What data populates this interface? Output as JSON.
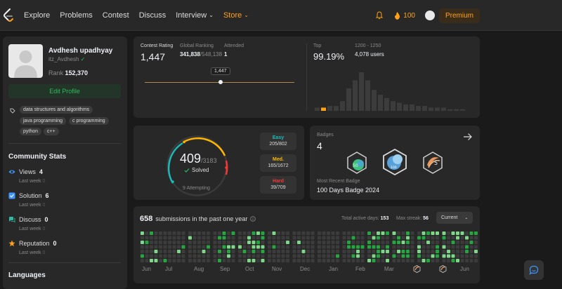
{
  "nav": {
    "items": [
      "Explore",
      "Problems",
      "Contest",
      "Discuss",
      "Interview",
      "Store"
    ],
    "coins": "100",
    "premium": "Premium"
  },
  "profile": {
    "name": "Avdhesh upadhyay",
    "handle": "itz_Avdhesh",
    "rank_label": "Rank",
    "rank": "152,370",
    "edit": "Edit Profile",
    "tags": [
      "data structures and algorithms",
      "java programming",
      "c programming",
      "python",
      "c++"
    ]
  },
  "community": {
    "title": "Community Stats",
    "stats": [
      {
        "label": "Views",
        "value": "4",
        "sub": "Last week",
        "delta": "0",
        "color": "#3e97ff"
      },
      {
        "label": "Solution",
        "value": "6",
        "sub": "Last week",
        "delta": "0",
        "color": "#3e97ff"
      },
      {
        "label": "Discuss",
        "value": "0",
        "sub": "Last week",
        "delta": "0",
        "color": "#2cbba4"
      },
      {
        "label": "Reputation",
        "value": "0",
        "sub": "Last week",
        "delta": "0",
        "color": "#ffa116"
      }
    ],
    "languages": "Languages"
  },
  "contest": {
    "rating_label": "Contest Rating",
    "rating": "1,447",
    "global_label": "Global Ranking",
    "global_rank": "341,838",
    "global_total": "/548,138",
    "attended_label": "Attended",
    "attended": "1",
    "tooltip": "1,447",
    "top_label": "Top",
    "top_pct": "99.19%",
    "range_label": "1200 - 1250",
    "users": "4,078 users",
    "histogram": [
      2,
      2,
      3,
      3,
      6,
      14,
      19,
      24,
      19,
      13,
      10,
      8,
      6,
      5,
      4,
      4,
      3,
      3,
      2,
      2,
      2,
      1,
      1,
      1
    ],
    "histogram_highlight_index": 1
  },
  "solved": {
    "count": "409",
    "total": "/3183",
    "label": "Solved",
    "attempting": "9 Attempting",
    "difficulty": [
      {
        "name": "Easy",
        "value": "205/802",
        "color": "#1cbaba"
      },
      {
        "name": "Med.",
        "value": "165/1672",
        "color": "#ffb700"
      },
      {
        "name": "Hard",
        "value": "39/709",
        "color": "#f63737"
      }
    ]
  },
  "badges": {
    "title": "Badges",
    "count": "4",
    "recent_label": "Most Recent Badge",
    "recent": "100 Days Badge 2024",
    "badge_text": [
      "50",
      "100",
      "5"
    ]
  },
  "submissions": {
    "count": "658",
    "text": "submissions in the past one year",
    "active_label": "Total active days:",
    "active": "153",
    "streak_label": "Max streak:",
    "streak": "56",
    "dropdown": "Current",
    "months": [
      "Jun",
      "Jul",
      "Aug",
      "Sep",
      "Oct",
      "Nov",
      "Dec",
      "Jan",
      "Feb",
      "Mar",
      "Jun"
    ]
  }
}
